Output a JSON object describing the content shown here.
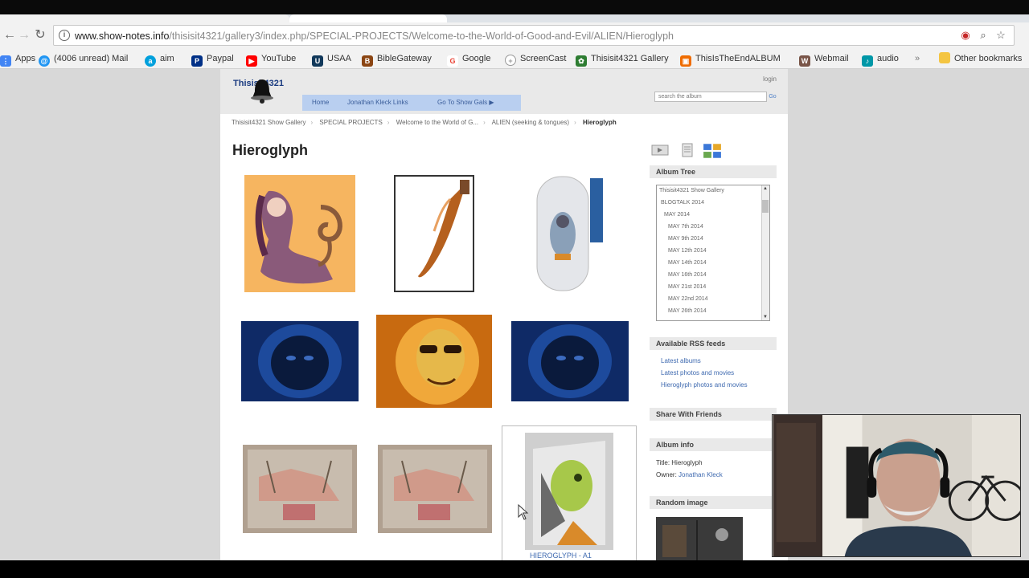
{
  "browser": {
    "url_host": "www.show-notes.info",
    "url_path": "/thisisit4321/gallery3/index.php/SPECIAL-PROJECTS/Welcome-to-the-World-of-Good-and-Evil/ALIEN/Hieroglyph",
    "bookmarks": [
      {
        "label": "Apps",
        "icon": "apps-grid-icon",
        "color": "#4285f4"
      },
      {
        "label": "(4006 unread) Mail",
        "icon": "mail-icon",
        "color": "#2196f3"
      },
      {
        "label": "aim",
        "icon": "aim-icon",
        "color": "#00a0dc"
      },
      {
        "label": "Paypal",
        "icon": "paypal-icon",
        "color": "#003087"
      },
      {
        "label": "YouTube",
        "icon": "youtube-icon",
        "color": "#ff0000"
      },
      {
        "label": "USAA",
        "icon": "usaa-icon",
        "color": "#12395b"
      },
      {
        "label": "BibleGateway",
        "icon": "biblegateway-icon",
        "color": "#8b4513"
      },
      {
        "label": "Google",
        "icon": "google-icon",
        "color": "#ea4335"
      },
      {
        "label": "ScreenCast",
        "icon": "screencast-icon",
        "color": "#999999"
      },
      {
        "label": "Thisisit4321 Gallery",
        "icon": "gallery-icon",
        "color": "#2e7d32"
      },
      {
        "label": "ThisIsTheEndALBUM",
        "icon": "album-icon",
        "color": "#ef6c00"
      },
      {
        "label": "Webmail",
        "icon": "webmail-icon",
        "color": "#795548"
      },
      {
        "label": "audio",
        "icon": "audio-icon",
        "color": "#0097a7"
      },
      {
        "label": "Other bookmarks",
        "icon": "folder-icon",
        "color": "#f4c542"
      }
    ]
  },
  "site": {
    "logo_text": "Thisisit4321",
    "login": "login",
    "menu": [
      "Home",
      "Jonathan Kleck Links",
      "Go To Show Gals ▶"
    ],
    "search_placeholder": "search the album",
    "breadcrumbs": [
      "Thisisit4321 Show Gallery",
      "SPECIAL PROJECTS",
      "Welcome to the World of G...",
      "ALIEN (seeking & tongues)",
      "Hieroglyph"
    ],
    "album_title": "Hieroglyph",
    "last_caption": "HIEROGLYPH - A1"
  },
  "sidebar": {
    "album_tree_title": "Album Tree",
    "tree_items": [
      "Thisisit4321 Show Gallery",
      "BLOGTALK 2014",
      "MAY 2014",
      "MAY 7th 2014",
      "MAY 9th 2014",
      "MAY 12th 2014",
      "MAY 14th 2014",
      "MAY 16th 2014",
      "MAY 21st 2014",
      "MAY 22nd 2014",
      "MAY 26th 2014"
    ],
    "rss_title": "Available RSS feeds",
    "rss_items": [
      "Latest albums",
      "Latest photos and movies",
      "Hieroglyph photos and movies"
    ],
    "share_title": "Share With Friends",
    "info_title": "Album info",
    "info_title_label": "Title:",
    "info_title_value": "Hieroglyph",
    "info_owner_label": "Owner:",
    "info_owner_value": "Jonathan Kleck",
    "random_title": "Random image"
  },
  "colors": {
    "menu_bg": "#b9cff0",
    "link": "#3f6ab0",
    "header_bg": "#e9e9e9"
  }
}
